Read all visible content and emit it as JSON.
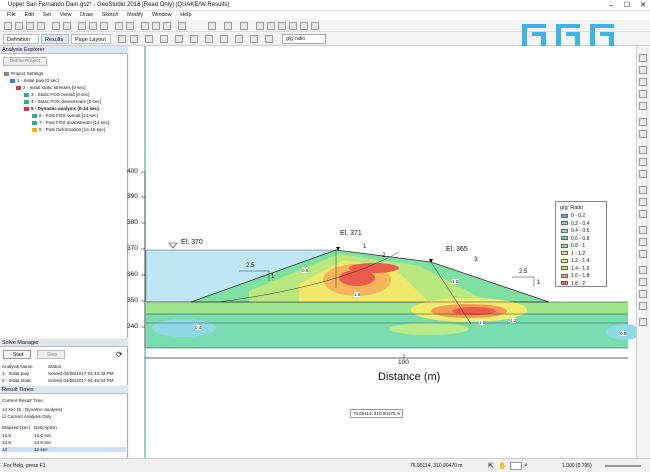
{
  "window": {
    "title": "Upper San Fernando Dam.gsz* - GeoStudio 2018 [Read Only] (QUAKE/W Results)"
  },
  "menu": [
    "File",
    "Edit",
    "Set",
    "View",
    "Draw",
    "Sketch",
    "Modify",
    "Window",
    "Help"
  ],
  "toolbar2": {
    "definition": "Definition",
    "results": "Results",
    "page_layout": "Page Layout",
    "ratio_field": "g/g' ratio"
  },
  "analysis_explorer": {
    "title": "Analysis Explorer",
    "define_project": "Define Project",
    "items": [
      {
        "label": "Project Settings",
        "level": 0
      },
      {
        "label": "1 - Initial pwp [0 sec]",
        "level": 1
      },
      {
        "label": "2 - Initial static stresses [0 sec]",
        "level": 2
      },
      {
        "label": "3 - Static FOS overall [0 sec]",
        "level": 3
      },
      {
        "label": "4 - Static FOS downstream [0 sec]",
        "level": 3
      },
      {
        "label": "5 - Dynamic analysis [0-14 sec]",
        "level": 2
      },
      {
        "label": "6 - Post FOS overall [14 sec]",
        "level": 3
      },
      {
        "label": "7 - Post FOS downstream [14 sec]",
        "level": 3
      },
      {
        "label": "8 - Post Deformation [14-15 sec]",
        "level": 3
      }
    ]
  },
  "solve_manager": {
    "title": "Solve Manager",
    "start": "Start",
    "stop": "Stop",
    "col_name": "Analysis Name",
    "col_status": "Status",
    "rows": [
      {
        "name": "1 - Initial pwp",
        "status": "Solved 04/06/2017 04:44:42 PM"
      },
      {
        "name": "2 - Initial static",
        "status": "Solved 04/06/2017 04:45:04 PM"
      }
    ]
  },
  "result_times": {
    "title": "Result Times",
    "current_label": "Current Result Time:",
    "current_value": "14 sec (5 - Dynamic analysis)",
    "checkbox": "Current Analysis Only",
    "col_elapsed": "Elapsed (sec)",
    "col_description": "Description",
    "rows": [
      {
        "elapsed": "13.6",
        "desc": "13.6 sec"
      },
      {
        "elapsed": "13.8",
        "desc": "13.8 sec"
      },
      {
        "elapsed": "14",
        "desc": "14 sec"
      }
    ]
  },
  "plot": {
    "y_ticks": [
      "400",
      "390",
      "380",
      "370",
      "360",
      "350",
      "340"
    ],
    "x_tick": "100",
    "x_label": "Distance (m)",
    "elev_labels": [
      "El. 370",
      "El. 371",
      "El. 365"
    ],
    "slope_labels": [
      "2.5",
      "1",
      "2.5",
      "1"
    ],
    "region_labels": [
      "1",
      "2",
      "3"
    ],
    "coord_readout": "76.05114, 310.00470 m",
    "contour_labels": [
      "0.6",
      "1.8",
      "1.6",
      "1.2",
      "0.4",
      "1.8",
      "0.6"
    ]
  },
  "legend": {
    "title": "g/g' Ratio",
    "items": [
      {
        "label": "0 - 0.2",
        "color": "#5fa3e8"
      },
      {
        "label": "0.2 - 0.4",
        "color": "#7fd0f0"
      },
      {
        "label": "0.4 - 0.6",
        "color": "#8ae6cf"
      },
      {
        "label": "0.6 - 0.8",
        "color": "#6fdc9a"
      },
      {
        "label": "0.8 - 1",
        "color": "#8fe27a"
      },
      {
        "label": "1 - 1.2",
        "color": "#c9ec74"
      },
      {
        "label": "1.2 - 1.4",
        "color": "#f2ec6e"
      },
      {
        "label": "1.4 - 1.6",
        "color": "#f7c85a"
      },
      {
        "label": "1.6 - 1.8",
        "color": "#f59a4f"
      },
      {
        "label": "1.8 - 2",
        "color": "#ec5a4a"
      }
    ]
  },
  "status": {
    "left": "For Help, press F1",
    "coords": "76.05114, 310.00470 m",
    "zoom": "1.000 (0.795)"
  }
}
